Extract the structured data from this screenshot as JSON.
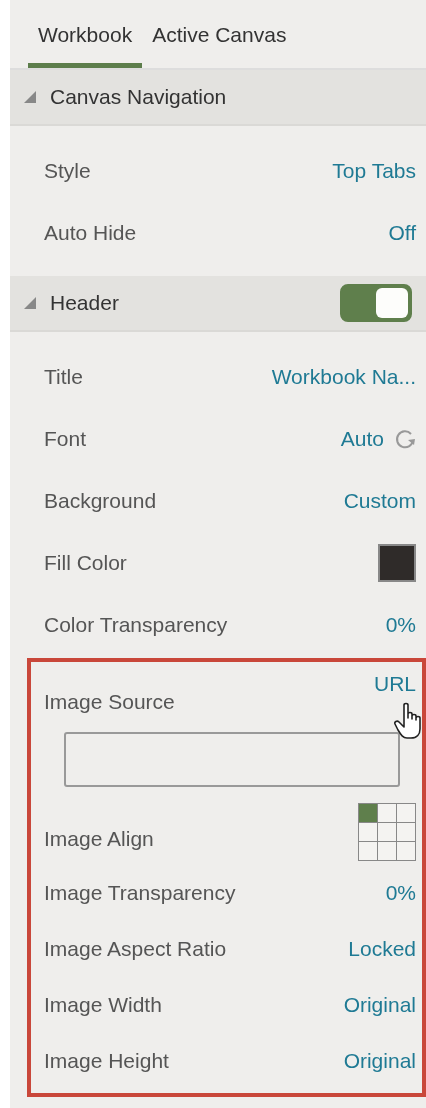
{
  "tabs": [
    {
      "label": "Workbook",
      "selected": true
    },
    {
      "label": "Active Canvas",
      "selected": false
    }
  ],
  "sections": [
    {
      "title": "Canvas Navigation",
      "expanded": true,
      "rows": [
        {
          "kind": "text",
          "label": "Style",
          "value": "Top Tabs"
        },
        {
          "kind": "text",
          "label": "Auto Hide",
          "value": "Off"
        }
      ]
    },
    {
      "title": "Header",
      "expanded": true,
      "toggle": {
        "on": true
      },
      "rows": [
        {
          "kind": "text",
          "label": "Title",
          "value": "Workbook Na..."
        },
        {
          "kind": "text_reset",
          "label": "Font",
          "value": "Auto"
        },
        {
          "kind": "text",
          "label": "Background",
          "value": "Custom"
        },
        {
          "kind": "swatch",
          "label": "Fill Color",
          "color": "#2f2b29"
        },
        {
          "kind": "text",
          "label": "Color Transparency",
          "value": "0%"
        }
      ],
      "highlighted_rows": [
        {
          "kind": "source",
          "label": "Image Source",
          "value": "URL"
        },
        {
          "kind": "align_grid",
          "label": "Image Align",
          "cells": [
            {
              "selected": true
            },
            {
              "selected": false
            },
            {
              "selected": false
            },
            {
              "selected": false
            },
            {
              "selected": false
            },
            {
              "selected": false
            },
            {
              "selected": false
            },
            {
              "selected": false
            },
            {
              "selected": false
            }
          ]
        },
        {
          "kind": "text",
          "label": "Image Transparency",
          "value": "0%"
        },
        {
          "kind": "text",
          "label": "Image Aspect Ratio",
          "value": "Locked"
        },
        {
          "kind": "text",
          "label": "Image Width",
          "value": "Original"
        },
        {
          "kind": "text",
          "label": "Image Height",
          "value": "Original"
        }
      ]
    }
  ]
}
